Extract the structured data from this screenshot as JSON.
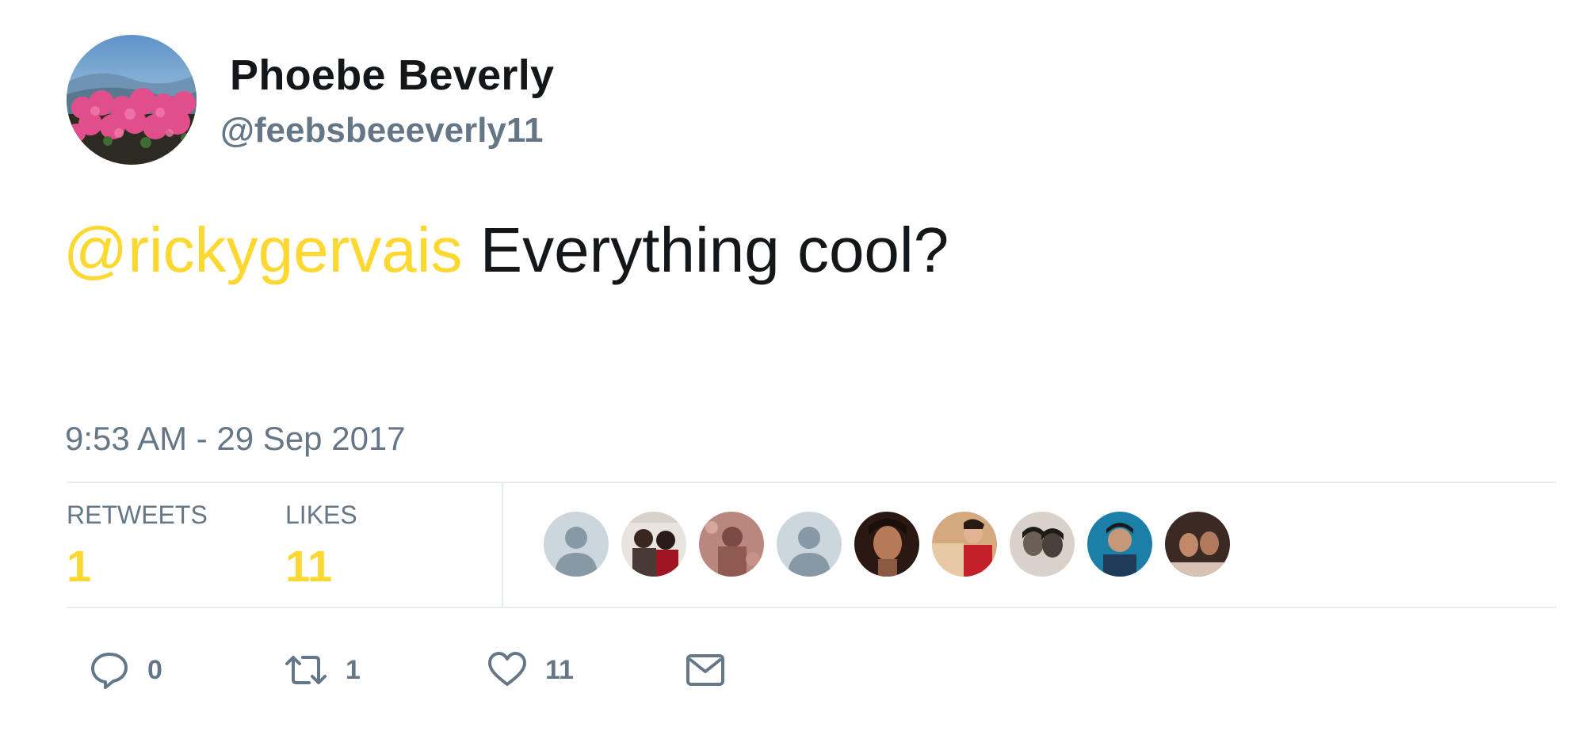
{
  "author": {
    "display_name": "Phoebe Beverly",
    "handle": "@feebsbeeeverly11",
    "avatar_icon": "profile-photo-flowers"
  },
  "tweet": {
    "mention": "@rickygervais",
    "text": " Everything cool?",
    "timestamp": "9:53 AM - 29 Sep 2017"
  },
  "stats": {
    "retweets_label": "RETWEETS",
    "retweets_value": "1",
    "likes_label": "LIKES",
    "likes_value": "11"
  },
  "liker_avatars": [
    "default-avatar",
    "photo-avatar",
    "photo-avatar",
    "default-avatar",
    "photo-avatar",
    "photo-avatar",
    "photo-avatar",
    "photo-avatar",
    "photo-avatar"
  ],
  "actions": {
    "reply_count": "0",
    "retweet_count": "1",
    "like_count": "11",
    "message_icon": "envelope-icon"
  },
  "colors": {
    "accent": "#fcd830",
    "text": "#14171a",
    "secondary": "#657786",
    "divider": "#e6ecf0"
  }
}
